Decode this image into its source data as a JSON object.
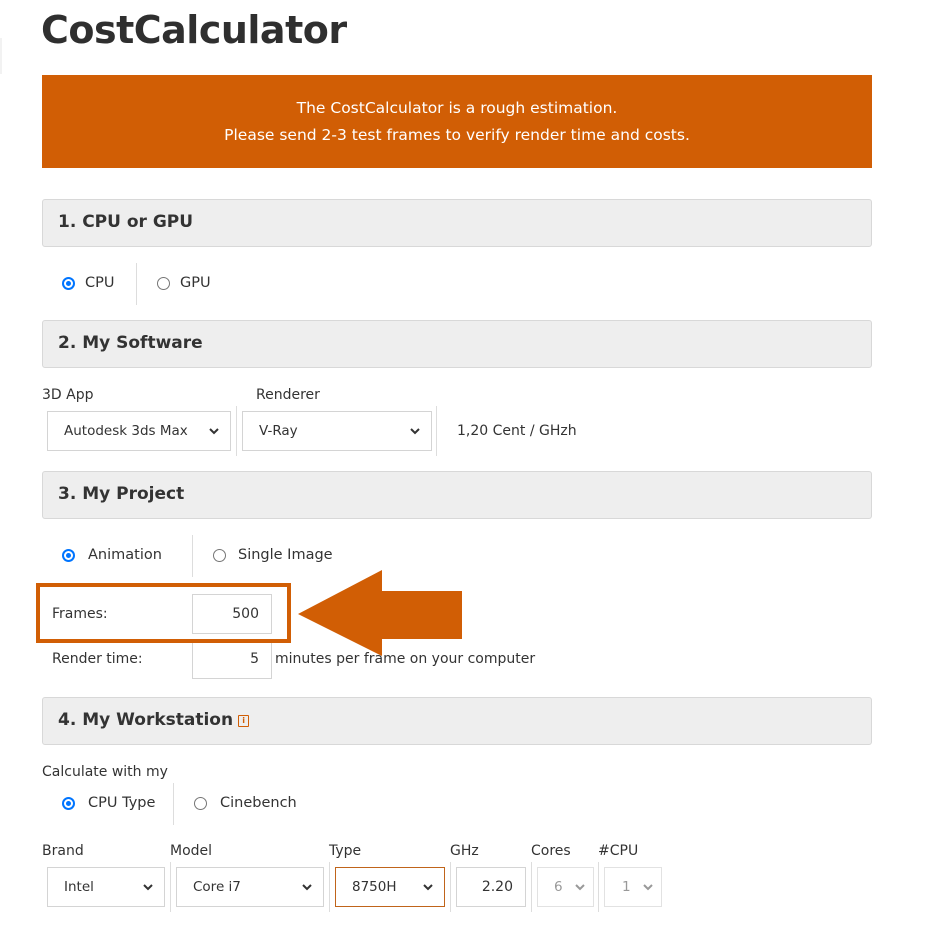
{
  "page": {
    "title": "CostCalculator",
    "banner": {
      "line1": "The CostCalculator is a rough estimation.",
      "line2": "Please send 2-3 test frames to verify render time and costs."
    }
  },
  "sections": {
    "cpu_gpu": {
      "title": "1. CPU or GPU",
      "options": [
        {
          "label": "CPU",
          "checked": true
        },
        {
          "label": "GPU",
          "checked": false
        }
      ]
    },
    "software": {
      "title": "2. My Software",
      "app_label": "3D App",
      "app_value": "Autodesk 3ds Max",
      "renderer_label": "Renderer",
      "renderer_value": "V-Ray",
      "rate": "1,20 Cent / GHzh"
    },
    "project": {
      "title": "3. My Project",
      "options": [
        {
          "label": "Animation",
          "checked": true
        },
        {
          "label": "Single Image",
          "checked": false
        }
      ],
      "frames_label": "Frames:",
      "frames_value": "500",
      "render_time_label": "Render time:",
      "render_time_value": "5",
      "render_time_unit": "minutes per frame on your computer"
    },
    "workstation": {
      "title": "4. My Workstation",
      "info_icon": "info-icon",
      "calc_label": "Calculate with my",
      "options": [
        {
          "label": "CPU Type",
          "checked": true
        },
        {
          "label": "Cinebench",
          "checked": false
        }
      ],
      "fields": {
        "brand": {
          "label": "Brand",
          "value": "Intel"
        },
        "model": {
          "label": "Model",
          "value": "Core i7"
        },
        "type": {
          "label": "Type",
          "value": "8750H"
        },
        "ghz": {
          "label": "GHz",
          "value": "2.20"
        },
        "cores": {
          "label": "Cores",
          "value": "6"
        },
        "cpu_count": {
          "label": "#CPU",
          "value": "1"
        }
      }
    }
  },
  "annotation": {
    "highlight_color": "#d15e05",
    "arrow_color": "#d15e05"
  }
}
